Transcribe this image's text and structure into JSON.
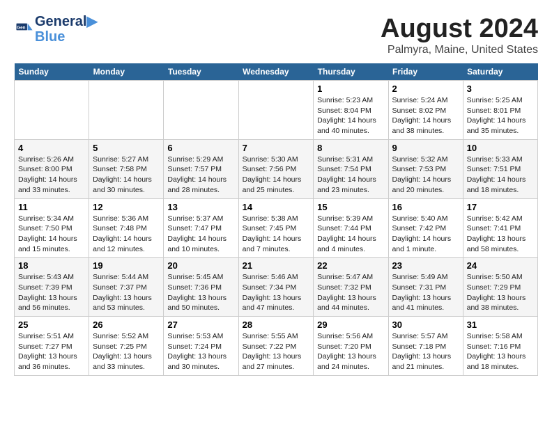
{
  "logo": {
    "line1": "General",
    "line2": "Blue"
  },
  "title": "August 2024",
  "subtitle": "Palmyra, Maine, United States",
  "days_of_week": [
    "Sunday",
    "Monday",
    "Tuesday",
    "Wednesday",
    "Thursday",
    "Friday",
    "Saturday"
  ],
  "weeks": [
    [
      {
        "day": "",
        "info": ""
      },
      {
        "day": "",
        "info": ""
      },
      {
        "day": "",
        "info": ""
      },
      {
        "day": "",
        "info": ""
      },
      {
        "day": "1",
        "info": "Sunrise: 5:23 AM\nSunset: 8:04 PM\nDaylight: 14 hours\nand 40 minutes."
      },
      {
        "day": "2",
        "info": "Sunrise: 5:24 AM\nSunset: 8:02 PM\nDaylight: 14 hours\nand 38 minutes."
      },
      {
        "day": "3",
        "info": "Sunrise: 5:25 AM\nSunset: 8:01 PM\nDaylight: 14 hours\nand 35 minutes."
      }
    ],
    [
      {
        "day": "4",
        "info": "Sunrise: 5:26 AM\nSunset: 8:00 PM\nDaylight: 14 hours\nand 33 minutes."
      },
      {
        "day": "5",
        "info": "Sunrise: 5:27 AM\nSunset: 7:58 PM\nDaylight: 14 hours\nand 30 minutes."
      },
      {
        "day": "6",
        "info": "Sunrise: 5:29 AM\nSunset: 7:57 PM\nDaylight: 14 hours\nand 28 minutes."
      },
      {
        "day": "7",
        "info": "Sunrise: 5:30 AM\nSunset: 7:56 PM\nDaylight: 14 hours\nand 25 minutes."
      },
      {
        "day": "8",
        "info": "Sunrise: 5:31 AM\nSunset: 7:54 PM\nDaylight: 14 hours\nand 23 minutes."
      },
      {
        "day": "9",
        "info": "Sunrise: 5:32 AM\nSunset: 7:53 PM\nDaylight: 14 hours\nand 20 minutes."
      },
      {
        "day": "10",
        "info": "Sunrise: 5:33 AM\nSunset: 7:51 PM\nDaylight: 14 hours\nand 18 minutes."
      }
    ],
    [
      {
        "day": "11",
        "info": "Sunrise: 5:34 AM\nSunset: 7:50 PM\nDaylight: 14 hours\nand 15 minutes."
      },
      {
        "day": "12",
        "info": "Sunrise: 5:36 AM\nSunset: 7:48 PM\nDaylight: 14 hours\nand 12 minutes."
      },
      {
        "day": "13",
        "info": "Sunrise: 5:37 AM\nSunset: 7:47 PM\nDaylight: 14 hours\nand 10 minutes."
      },
      {
        "day": "14",
        "info": "Sunrise: 5:38 AM\nSunset: 7:45 PM\nDaylight: 14 hours\nand 7 minutes."
      },
      {
        "day": "15",
        "info": "Sunrise: 5:39 AM\nSunset: 7:44 PM\nDaylight: 14 hours\nand 4 minutes."
      },
      {
        "day": "16",
        "info": "Sunrise: 5:40 AM\nSunset: 7:42 PM\nDaylight: 14 hours\nand 1 minute."
      },
      {
        "day": "17",
        "info": "Sunrise: 5:42 AM\nSunset: 7:41 PM\nDaylight: 13 hours\nand 58 minutes."
      }
    ],
    [
      {
        "day": "18",
        "info": "Sunrise: 5:43 AM\nSunset: 7:39 PM\nDaylight: 13 hours\nand 56 minutes."
      },
      {
        "day": "19",
        "info": "Sunrise: 5:44 AM\nSunset: 7:37 PM\nDaylight: 13 hours\nand 53 minutes."
      },
      {
        "day": "20",
        "info": "Sunrise: 5:45 AM\nSunset: 7:36 PM\nDaylight: 13 hours\nand 50 minutes."
      },
      {
        "day": "21",
        "info": "Sunrise: 5:46 AM\nSunset: 7:34 PM\nDaylight: 13 hours\nand 47 minutes."
      },
      {
        "day": "22",
        "info": "Sunrise: 5:47 AM\nSunset: 7:32 PM\nDaylight: 13 hours\nand 44 minutes."
      },
      {
        "day": "23",
        "info": "Sunrise: 5:49 AM\nSunset: 7:31 PM\nDaylight: 13 hours\nand 41 minutes."
      },
      {
        "day": "24",
        "info": "Sunrise: 5:50 AM\nSunset: 7:29 PM\nDaylight: 13 hours\nand 38 minutes."
      }
    ],
    [
      {
        "day": "25",
        "info": "Sunrise: 5:51 AM\nSunset: 7:27 PM\nDaylight: 13 hours\nand 36 minutes."
      },
      {
        "day": "26",
        "info": "Sunrise: 5:52 AM\nSunset: 7:25 PM\nDaylight: 13 hours\nand 33 minutes."
      },
      {
        "day": "27",
        "info": "Sunrise: 5:53 AM\nSunset: 7:24 PM\nDaylight: 13 hours\nand 30 minutes."
      },
      {
        "day": "28",
        "info": "Sunrise: 5:55 AM\nSunset: 7:22 PM\nDaylight: 13 hours\nand 27 minutes."
      },
      {
        "day": "29",
        "info": "Sunrise: 5:56 AM\nSunset: 7:20 PM\nDaylight: 13 hours\nand 24 minutes."
      },
      {
        "day": "30",
        "info": "Sunrise: 5:57 AM\nSunset: 7:18 PM\nDaylight: 13 hours\nand 21 minutes."
      },
      {
        "day": "31",
        "info": "Sunrise: 5:58 AM\nSunset: 7:16 PM\nDaylight: 13 hours\nand 18 minutes."
      }
    ]
  ]
}
